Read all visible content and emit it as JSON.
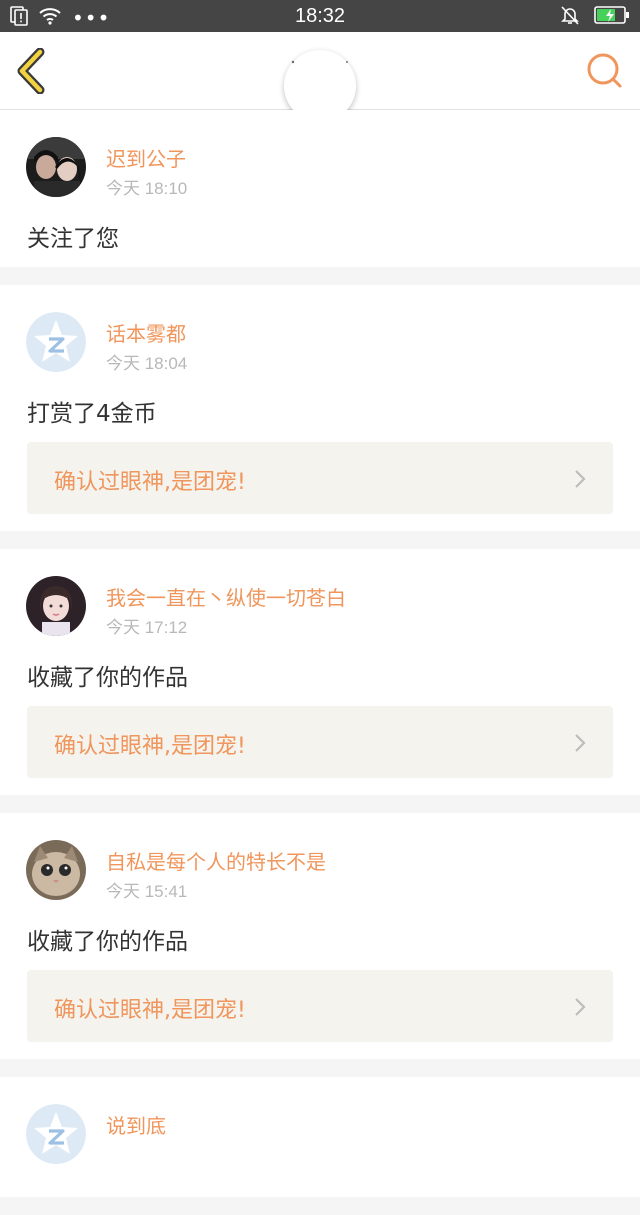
{
  "status_bar": {
    "time": "18:32",
    "dots": "•••"
  },
  "header": {
    "back_icon": "chevron-left-icon",
    "search_icon": "search-icon"
  },
  "colors": {
    "accent": "#f0965c",
    "card_bg": "#f4f3ee",
    "status_bg": "#454545"
  },
  "notifications": [
    {
      "user": "迟到公子",
      "time": "今天 18:10",
      "action": "关注了您",
      "avatar": "couple-photo"
    },
    {
      "user": "话本雾都",
      "time": "今天 18:04",
      "action": "打赏了4金币",
      "work": "确认过眼神,是团宠!",
      "avatar": "default-avatar"
    },
    {
      "user": "我会一直在丶纵使一切苍白",
      "time": "今天 17:12",
      "action": "收藏了你的作品",
      "work": "确认过眼神,是团宠!",
      "avatar": "girl-photo"
    },
    {
      "user": "自私是每个人的特长不是",
      "time": "今天 15:41",
      "action": "收藏了你的作品",
      "work": "确认过眼神,是团宠!",
      "avatar": "cat-photo"
    },
    {
      "user": "说到底",
      "avatar": "default-avatar"
    }
  ]
}
